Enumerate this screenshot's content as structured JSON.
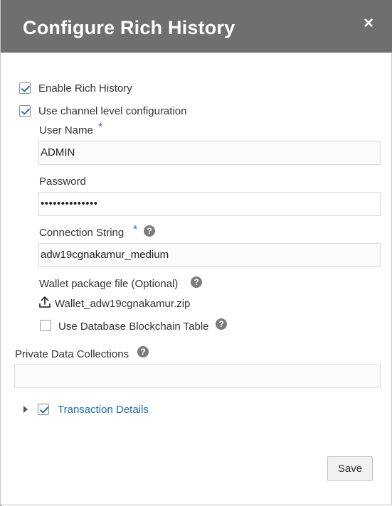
{
  "dialog": {
    "title": "Configure Rich History",
    "close_glyph": "×"
  },
  "form": {
    "enable_rich_history": {
      "label": "Enable Rich History",
      "checked": true
    },
    "use_channel_config": {
      "label": "Use channel level configuration",
      "checked": true
    },
    "user_name": {
      "label": "User Name",
      "required_mark": "*",
      "value": "ADMIN"
    },
    "password": {
      "label": "Password",
      "value": "••••••••••••••"
    },
    "connection_string": {
      "label": "Connection String",
      "required_mark": "*",
      "value": "adw19cgnakamur_medium",
      "help_glyph": "?"
    },
    "wallet": {
      "label": "Wallet package file (Optional)",
      "file_name": "Wallet_adw19cgnakamur.zip",
      "help_glyph": "?"
    },
    "blockchain_table": {
      "label": "Use Database Blockchain Table",
      "checked": false,
      "help_glyph": "?"
    },
    "private_data": {
      "label": "Private Data Collections",
      "value": "",
      "help_glyph": "?"
    },
    "transaction_details": {
      "label": "Transaction Details",
      "checked": true
    }
  },
  "footer": {
    "save_label": "Save"
  },
  "icons": {
    "close": "close-icon",
    "help": "help-icon",
    "upload": "upload-icon",
    "expand": "caret-right-icon",
    "checkmark": "checkmark-icon"
  },
  "colors": {
    "header_bg": "#6f6f6f",
    "checkmark": "#1e6fbf",
    "required": "#1e6fbf",
    "link": "#1b6bb0"
  }
}
